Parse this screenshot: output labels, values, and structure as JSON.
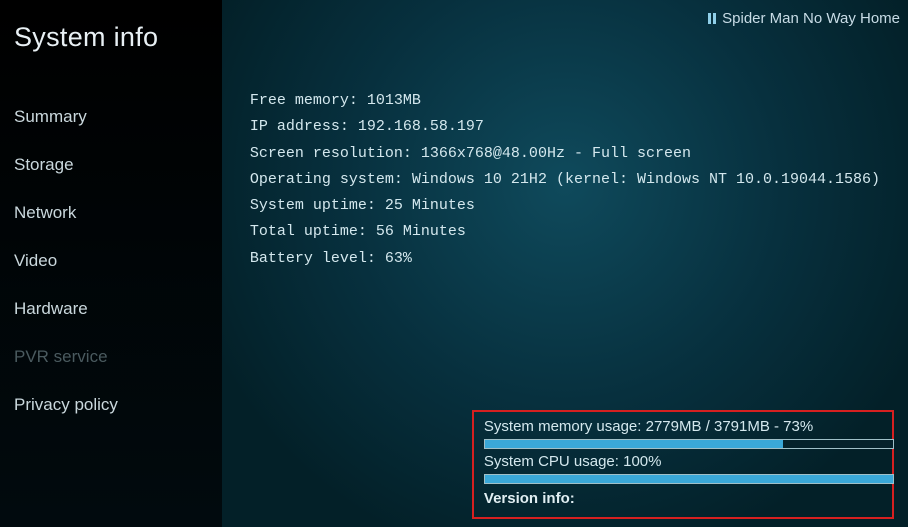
{
  "page_title": "System info",
  "now_playing": "Spider Man No Way Home",
  "sidebar": {
    "items": [
      {
        "label": "Summary",
        "disabled": false
      },
      {
        "label": "Storage",
        "disabled": false
      },
      {
        "label": "Network",
        "disabled": false
      },
      {
        "label": "Video",
        "disabled": false
      },
      {
        "label": "Hardware",
        "disabled": false
      },
      {
        "label": "PVR service",
        "disabled": true
      },
      {
        "label": "Privacy policy",
        "disabled": false
      }
    ]
  },
  "info": {
    "free_memory": "Free memory: 1013MB",
    "ip_address": "IP address: 192.168.58.197",
    "screen_resolution": "Screen resolution: 1366x768@48.00Hz - Full screen",
    "operating_system": "Operating system: Windows 10 21H2 (kernel: Windows NT 10.0.19044.1586)",
    "system_uptime": "System uptime: 25 Minutes",
    "total_uptime": "Total uptime: 56 Minutes",
    "battery_level": "Battery level: 63%"
  },
  "usage": {
    "memory_label": "System memory usage: 2779MB / 3791MB - 73%",
    "memory_percent": 73,
    "cpu_label": "System CPU usage: 100%",
    "cpu_percent": 100
  },
  "version_label": "Version info:"
}
